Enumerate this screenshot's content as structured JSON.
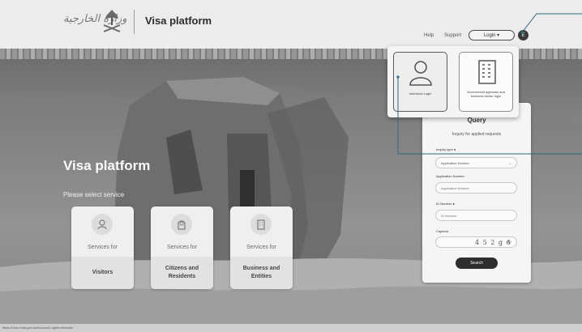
{
  "header": {
    "logo_arabic": "وزارة الخارجية",
    "platform_title": "Visa platform",
    "nav": {
      "help": "Help",
      "support": "Support"
    },
    "login_label": "Login ▾",
    "lang_label": "E"
  },
  "hero": {
    "title": "Visa platform",
    "subtitle": "Please select service",
    "services": [
      {
        "line1": "Services for",
        "line2": "Visitors",
        "icon": "person-icon"
      },
      {
        "line1": "Services for",
        "line2": "Citizens and Residents",
        "icon": "resident-icon"
      },
      {
        "line1": "Services for",
        "line2": "Business and Entities",
        "icon": "building-icon"
      }
    ]
  },
  "login_menu": {
    "individual_label": "Individual Login",
    "business_label": "Government agencies and business sector login"
  },
  "query": {
    "title": "Query",
    "subtitle": "Inquiry for applied requests",
    "inquiry_type_label": "Inquiry type",
    "inquiry_type_value": "Application Number",
    "application_number_label": "Application Number",
    "application_number_placeholder": "Application Number",
    "id_number_label": "ID Number",
    "id_number_placeholder": "ID Number",
    "captcha_label": "Captcha",
    "captcha_text": "4 5 2 g 6",
    "search_label": "Search"
  },
  "status_bar": {
    "url": "https://visa.mofa.gov.sa/Account/LoginIndividuals"
  },
  "colors": {
    "dark": "#2e2e2e",
    "panel": "#f5f5f5"
  }
}
